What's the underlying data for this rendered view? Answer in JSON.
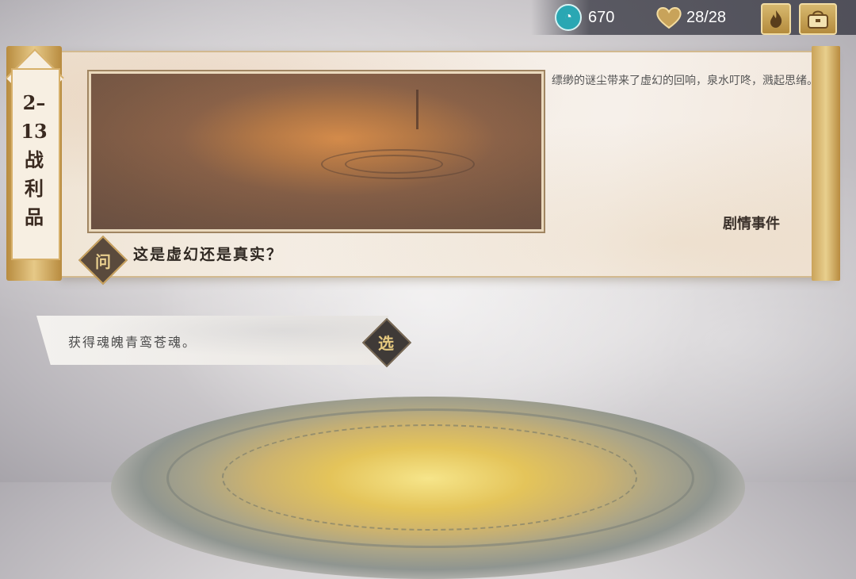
{
  "resources": {
    "spirit_value": "670",
    "stamina_value": "28/28",
    "spirit_icon": "spirit-orb-icon",
    "stamina_icon": "heart-icon"
  },
  "buttons": {
    "fire_icon": "flame-icon",
    "bag_icon": "bag-icon"
  },
  "chapter": {
    "label": "2–\n13\n战\n利\n品"
  },
  "event": {
    "description": "缥缈的谜尘带来了虚幻的回响，泉水叮咚，溅起思绪。",
    "type_label": "剧情事件",
    "question_badge": "问",
    "question": "这是虚幻还是真实？"
  },
  "choices": [
    {
      "text": "获得魂魄青鸾苍魂。",
      "badge": "选"
    }
  ],
  "colors": {
    "accent_gold": "#c9a25e",
    "badge_dark": "#3f3a37"
  }
}
